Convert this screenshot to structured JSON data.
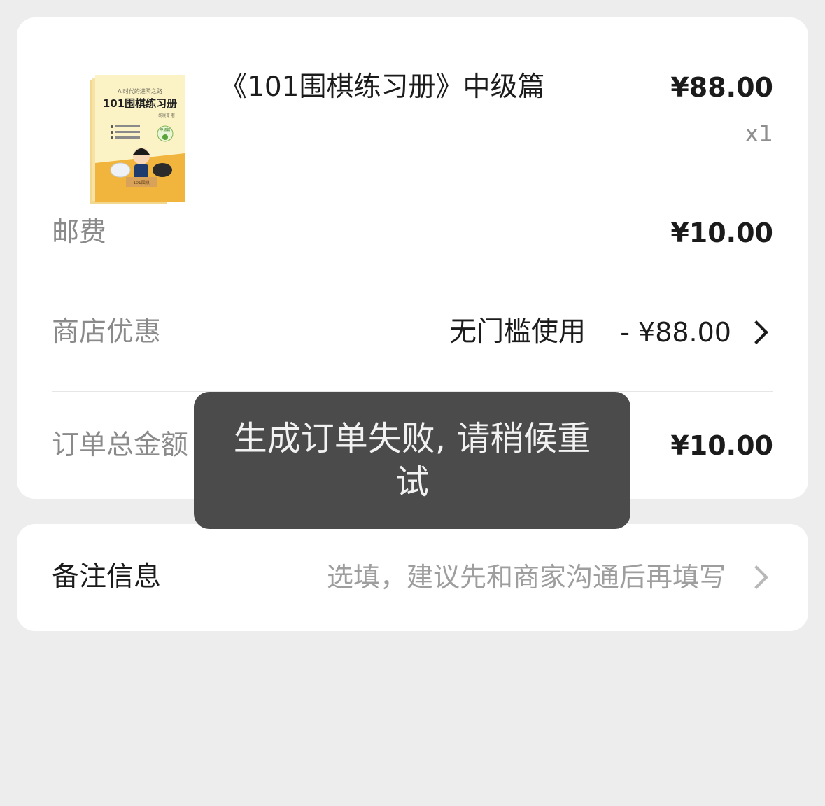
{
  "order": {
    "product": {
      "name": "《101围棋练习册》中级篇",
      "price": "¥88.00",
      "quantity": "x1",
      "cover": {
        "topline": "AI时代的进阶之路",
        "title": "101围棋练习册",
        "author": "胡晓苓 著",
        "level_badge": "中级篇",
        "bottom_label": "101围棋"
      }
    },
    "shipping": {
      "label": "邮费",
      "value": "¥10.00"
    },
    "discount": {
      "label": "商店优惠",
      "condition": "无门槛使用",
      "amount": "- ¥88.00"
    },
    "total": {
      "label": "订单总金额",
      "value": "¥10.00"
    }
  },
  "remark": {
    "label": "备注信息",
    "placeholder": "选填，建议先和商家沟通后再填写"
  },
  "toast": {
    "message": "生成订单失败, 请稍候重试"
  },
  "icons": {
    "chevron": "chevron-right-icon"
  },
  "colors": {
    "background": "#ededed",
    "card": "#ffffff",
    "toast": "#4b4b4b"
  }
}
